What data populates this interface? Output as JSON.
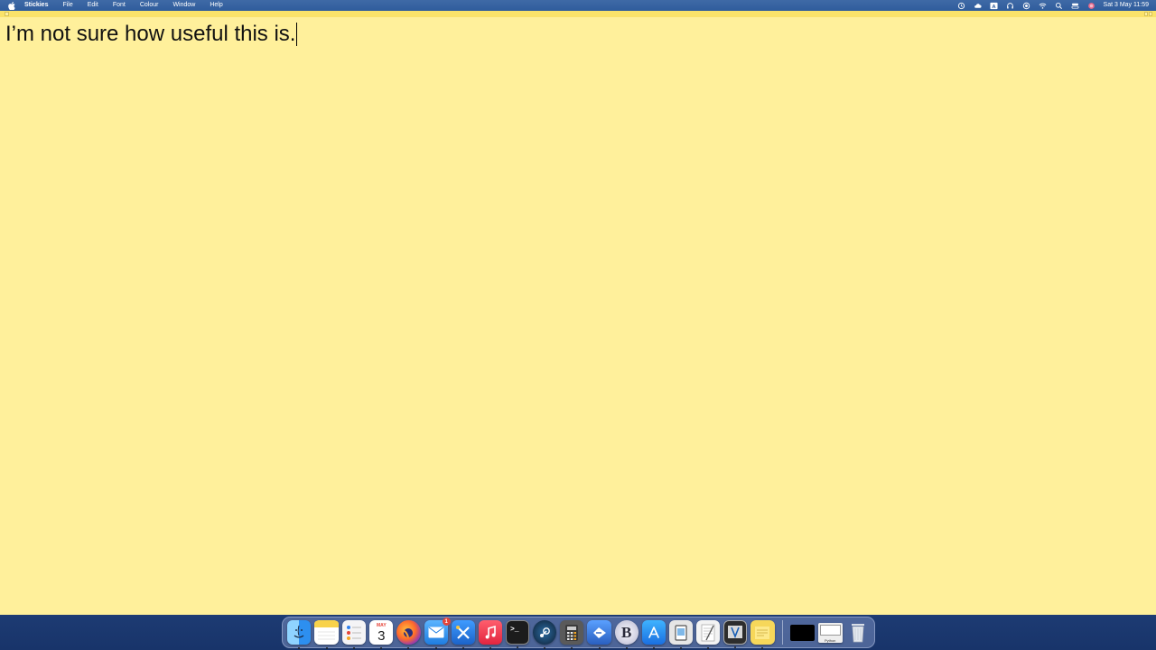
{
  "menubar": {
    "app_name": "Stickies",
    "menus": [
      "File",
      "Edit",
      "Font",
      "Colour",
      "Window",
      "Help"
    ],
    "clock": "Sat 3 May  11:59",
    "status_icons": [
      "time-machine-icon",
      "cloud-icon",
      "keyboard-input-icon",
      "headphones-icon",
      "screen-record-icon",
      "wifi-icon",
      "search-icon",
      "control-center-icon",
      "siri-icon"
    ]
  },
  "note": {
    "text": "I’m not sure how useful this is.",
    "background": "#fff09b",
    "titlebar_color": "#fbe36a"
  },
  "dock": {
    "apps": [
      {
        "name": "Finder",
        "icon": "finder-icon",
        "color": "#2d8ff0",
        "running": true
      },
      {
        "name": "Notes",
        "icon": "notes-icon",
        "color": "#f8d24a",
        "running": true
      },
      {
        "name": "Reminders",
        "icon": "reminders-icon",
        "color": "#f4f4f6",
        "running": true
      },
      {
        "name": "Calendar",
        "icon": "calendar-icon",
        "color": "#ffffff",
        "running": true,
        "month": "MAY",
        "day": "3"
      },
      {
        "name": "Firefox",
        "icon": "firefox-icon",
        "color": "#e25a2a",
        "running": true
      },
      {
        "name": "Mail",
        "icon": "mail-icon",
        "color": "#3b9cf2",
        "running": true,
        "badge": "1"
      },
      {
        "name": "Xcode Tools",
        "icon": "tools-icon",
        "color": "#2a7fd6",
        "running": true
      },
      {
        "name": "Music",
        "icon": "music-icon",
        "color": "#f04558",
        "running": true
      },
      {
        "name": "Terminal",
        "icon": "terminal-icon",
        "color": "#1c1c1c",
        "running": true
      },
      {
        "name": "Steam",
        "icon": "steam-icon",
        "color": "#1b2838",
        "running": true
      },
      {
        "name": "Calculator",
        "icon": "calculator-icon",
        "color": "#5a5a5a",
        "running": true
      },
      {
        "name": "Swift Playgrounds",
        "icon": "swift-icon",
        "color": "#3a7bd5",
        "running": true
      },
      {
        "name": "BBEdit",
        "icon": "bbedit-icon",
        "color": "#d8d8e8",
        "running": true
      },
      {
        "name": "App Store",
        "icon": "app-store-icon",
        "color": "#1f8ef1",
        "running": true
      },
      {
        "name": "Preview",
        "icon": "preview-icon",
        "color": "#e6e6e6",
        "running": true
      },
      {
        "name": "TextEdit",
        "icon": "textedit-icon",
        "color": "#f3f3f3",
        "running": true
      },
      {
        "name": "Vim",
        "icon": "vim-icon",
        "color": "#2d2d2d",
        "running": true
      },
      {
        "name": "Stickies",
        "icon": "stickies-icon",
        "color": "#f6d75a",
        "running": true
      }
    ],
    "minimized": [
      {
        "name": "Terminal window",
        "icon": "black-window-thumbnail-icon",
        "color": "#000000"
      },
      {
        "name": "Python window",
        "icon": "python-window-thumbnail-icon",
        "color": "#eeeeee",
        "label": "Python"
      }
    ],
    "trash": {
      "name": "Trash",
      "icon": "trash-icon",
      "color": "#dfe3ea"
    }
  }
}
